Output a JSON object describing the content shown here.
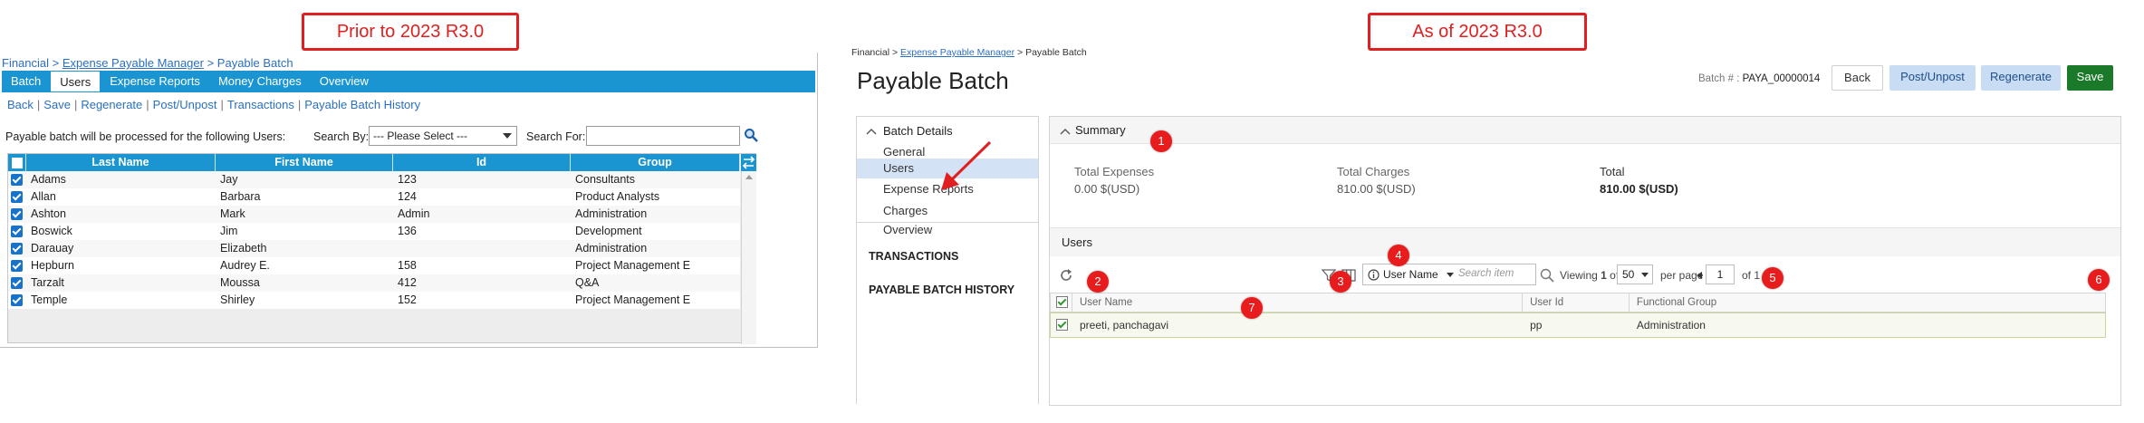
{
  "labels": {
    "before": "Prior to 2023 R3.0",
    "after": "As of 2023 R3.0"
  },
  "old": {
    "breadcrumb": {
      "root": "Financial",
      "sep": " > ",
      "mid": "Expense Payable Manager",
      "current": "Payable Batch"
    },
    "tabs": [
      "Batch",
      "Users",
      "Expense Reports",
      "Money Charges",
      "Overview"
    ],
    "actions": [
      "Back",
      "Save",
      "Regenerate",
      "Post/Unpost",
      "Transactions",
      "Payable Batch History"
    ],
    "message": "Payable batch will be processed for the following Users:",
    "search_by_label": "Search By:",
    "search_by_value": "--- Please Select ---",
    "search_for_label": "Search For:",
    "columns": [
      "Last Name",
      "First Name",
      "Id",
      "Group"
    ],
    "rows": [
      [
        "Adams",
        "Jay",
        "123",
        "Consultants"
      ],
      [
        "Allan",
        "Barbara",
        "124",
        "Product Analysts"
      ],
      [
        "Ashton",
        "Mark",
        "Admin",
        "Administration"
      ],
      [
        "Boswick",
        "Jim",
        "136",
        "Development"
      ],
      [
        "Darauay",
        "Elizabeth",
        "",
        "Administration"
      ],
      [
        "Hepburn",
        "Audrey E.",
        "158",
        "Project Management E"
      ],
      [
        "Tarzalt",
        "Moussa",
        "412",
        "Q&A"
      ],
      [
        "Temple",
        "Shirley",
        "152",
        "Project Management E"
      ]
    ]
  },
  "new": {
    "breadcrumb": {
      "root": "Financial",
      "sep": " > ",
      "mid": "Expense Payable Manager",
      "current": "Payable Batch"
    },
    "title": "Payable Batch",
    "batch_label": "Batch # : ",
    "batch_number": "PAYA_00000014",
    "buttons": {
      "back": "Back",
      "post": "Post/Unpost",
      "regenerate": "Regenerate",
      "save": "Save"
    },
    "nav": {
      "header": "Batch Details",
      "items": [
        "General",
        "Users",
        "Expense Reports",
        "Charges",
        "Overview"
      ],
      "sections": [
        "TRANSACTIONS",
        "PAYABLE BATCH HISTORY"
      ]
    },
    "summary": {
      "title": "Summary",
      "items": [
        {
          "label": "Total Expenses",
          "value": "0.00 $(USD)"
        },
        {
          "label": "Total Charges",
          "value": "810.00 $(USD)"
        },
        {
          "label": "Total",
          "value": "810.00 $(USD)"
        }
      ]
    },
    "users": {
      "title": "Users",
      "search_field": "User Name",
      "search_placeholder": "Search item",
      "viewing_prefix": "Viewing ",
      "viewing_current": "1",
      "viewing_of": " of ",
      "viewing_total": "1",
      "page_size": "50",
      "per_page": "per page",
      "page": "1",
      "of_pages": "of 1",
      "columns": [
        "User Name",
        "User Id",
        "Functional Group"
      ],
      "rows": [
        [
          "preeti, panchagavi",
          "pp",
          "Administration"
        ]
      ]
    },
    "badges": [
      "1",
      "2",
      "3",
      "4",
      "5",
      "6",
      "7"
    ]
  },
  "colors": {
    "accent_red": "#e02020",
    "old_header_blue": "#1a95d1",
    "save_green": "#1a7a2a",
    "selected_nav": "#d3e3f5"
  }
}
